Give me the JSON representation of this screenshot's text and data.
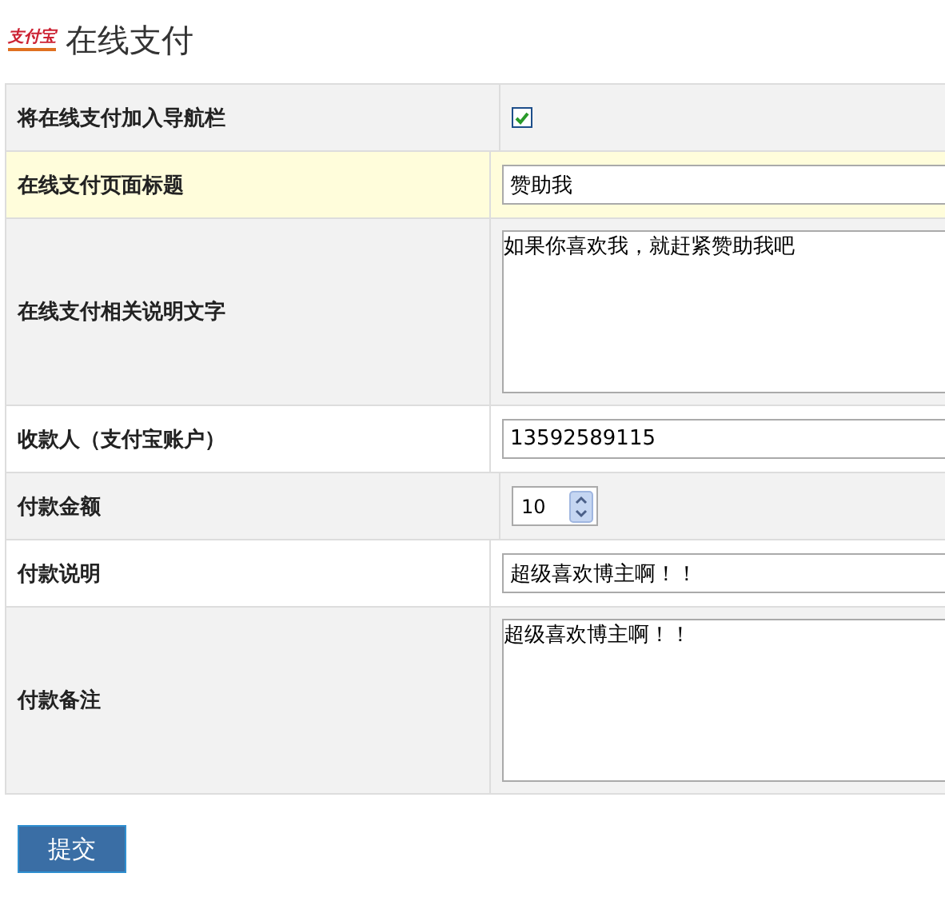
{
  "header": {
    "logo_text": "支付宝",
    "title": "在线支付"
  },
  "rows": [
    {
      "label": "将在线支付加入导航栏",
      "kind": "checkbox",
      "checked": true,
      "highlighted": false
    },
    {
      "label": "在线支付页面标题",
      "kind": "text",
      "value": "赞助我",
      "highlighted": true
    },
    {
      "label": "在线支付相关说明文字",
      "kind": "textarea",
      "value": "如果你喜欢我，就赶紧赞助我吧",
      "highlighted": false
    },
    {
      "label": "收款人（支付宝账户）",
      "kind": "text",
      "value": "13592589115",
      "highlighted": false
    },
    {
      "label": "付款金额",
      "kind": "number",
      "value": "10",
      "highlighted": false
    },
    {
      "label": "付款说明",
      "kind": "text",
      "value": "超级喜欢博主啊！！",
      "highlighted": false
    },
    {
      "label": "付款备注",
      "kind": "textarea",
      "value": "超级喜欢博主啊！！",
      "highlighted": false
    }
  ],
  "submit": "提交"
}
